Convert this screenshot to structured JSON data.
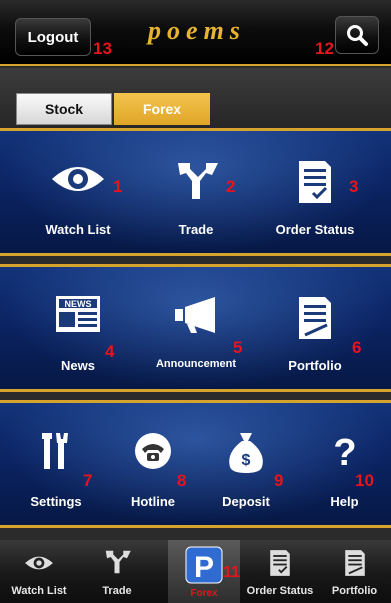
{
  "header": {
    "logout_label": "Logout",
    "logo_text": "poems",
    "search_icon": "search-icon"
  },
  "market_tabs": [
    {
      "label": "Stock",
      "selected": false
    },
    {
      "label": "Forex",
      "selected": true
    }
  ],
  "menu_rows": [
    [
      {
        "label": "Watch List",
        "icon": "eye-icon",
        "badge": "1"
      },
      {
        "label": "Trade",
        "icon": "trade-arrows-icon",
        "badge": "2"
      },
      {
        "label": "Order Status",
        "icon": "order-document-icon",
        "badge": "3"
      }
    ],
    [
      {
        "label": "News",
        "icon": "newspaper-icon",
        "badge": "4"
      },
      {
        "label": "Announcement",
        "icon": "megaphone-icon",
        "badge": "5"
      },
      {
        "label": "Portfolio",
        "icon": "portfolio-document-icon",
        "badge": "6"
      }
    ],
    [
      {
        "label": "Settings",
        "icon": "tools-icon",
        "badge": "7"
      },
      {
        "label": "Hotline",
        "icon": "phone-icon",
        "badge": "8"
      },
      {
        "label": "Deposit",
        "icon": "money-bag-icon",
        "badge": "9"
      },
      {
        "label": "Help",
        "icon": "question-icon",
        "badge": "10"
      }
    ]
  ],
  "bottom_nav": [
    {
      "label": "Watch List",
      "icon": "eye-icon"
    },
    {
      "label": "Trade",
      "icon": "trade-arrows-icon"
    },
    {
      "label": "Forex",
      "icon": "p-logo-icon",
      "active": true
    },
    {
      "label": "Order Status",
      "icon": "order-document-icon"
    },
    {
      "label": "Portfolio",
      "icon": "portfolio-document-icon"
    }
  ],
  "badges": {
    "logout": "13",
    "search": "12",
    "forex_nav": "11"
  },
  "colors": {
    "accent_gold": "#d6a32c",
    "badge_red": "#e8131b",
    "panel_blue": "#0a2260"
  }
}
